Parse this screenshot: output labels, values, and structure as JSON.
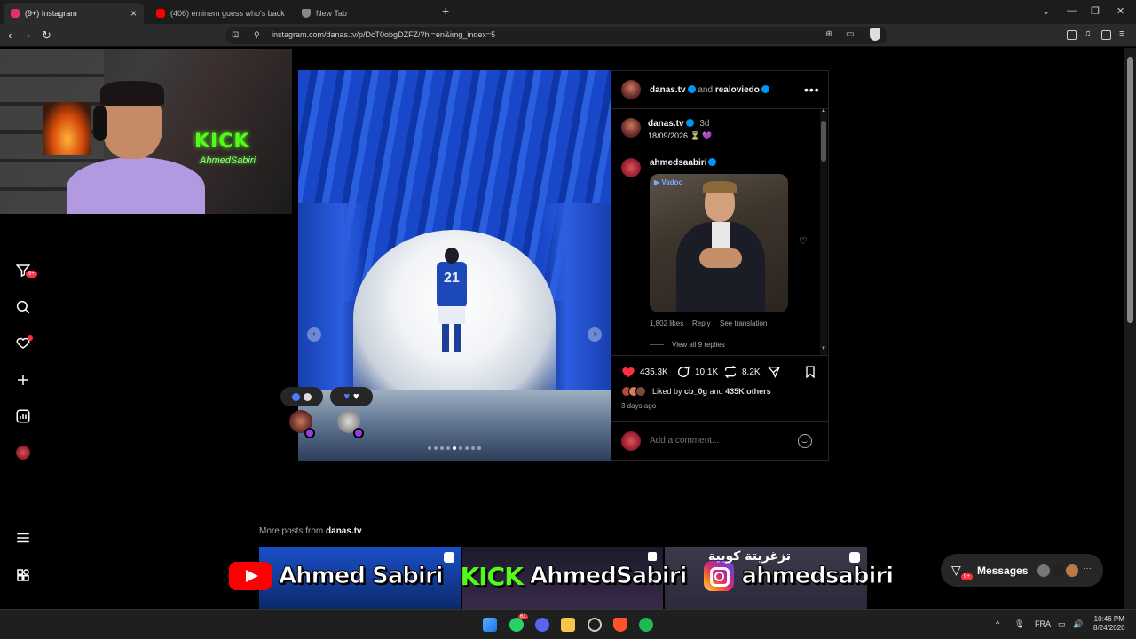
{
  "browser": {
    "tabs": [
      {
        "title": "(9+) Instagram",
        "active": true,
        "icon": "instagram-icon",
        "color": "#e1306c"
      },
      {
        "title": "(406) eminem guess who's back - Yo",
        "active": false,
        "icon": "youtube-icon",
        "color": "#ff0000"
      },
      {
        "title": "New Tab",
        "active": false,
        "icon": "brave-shield-icon",
        "color": "#888888"
      }
    ],
    "url": "instagram.com/danas.tv/p/DcT0obgDZFZ/?hl=en&img_index=5"
  },
  "sidebar": {
    "notifications_badge": "9+"
  },
  "stream_overlay": {
    "kick_text": "KICK",
    "kick_sub": "AhmedSabiri"
  },
  "post": {
    "header": {
      "author": "danas.tv",
      "connector": "and",
      "coauthor": "realoviedo"
    },
    "caption": {
      "author": "danas.tv",
      "age": "3d",
      "text": "18/09/2026 ⏳ 💜"
    },
    "comment": {
      "author": "ahmedsaabiri",
      "gif_label": "▶ Vadoo",
      "likes": "1,802 likes",
      "reply": "Reply",
      "translate": "See translation",
      "view_replies": "View all 9 replies"
    },
    "player_number": "21",
    "carousel_dots": 9,
    "carousel_active": 4,
    "actions": {
      "likes": "435.3K",
      "comments": "10.1K",
      "reposts": "8.2K"
    },
    "liked_by_prefix": "Liked by",
    "liked_by_user": "cb_0g",
    "liked_by_suffix": "and",
    "liked_by_others": "435K others",
    "time_ago": "3 days ago",
    "comment_placeholder": "Add a comment..."
  },
  "more_posts": {
    "prefix": "More posts from",
    "user": "danas.tv"
  },
  "banner": {
    "youtube_name": "Ahmed Sabiri",
    "kick_label": "KICK",
    "kick_name": "AhmedSabiri",
    "instagram_name": "ahmedsabiri",
    "arabic_text": "تزغريتة كوبية"
  },
  "messages_widget": {
    "label": "Messages",
    "badge": "9+"
  },
  "taskbar": {
    "lang": "FRA",
    "time": "10:46 PM",
    "date": "8/24/2026",
    "whatsapp_badge": "61"
  },
  "colors": {
    "instagram_blue": "#0095f6",
    "like_red": "#ff3040",
    "notification_red": "#ff3040"
  }
}
